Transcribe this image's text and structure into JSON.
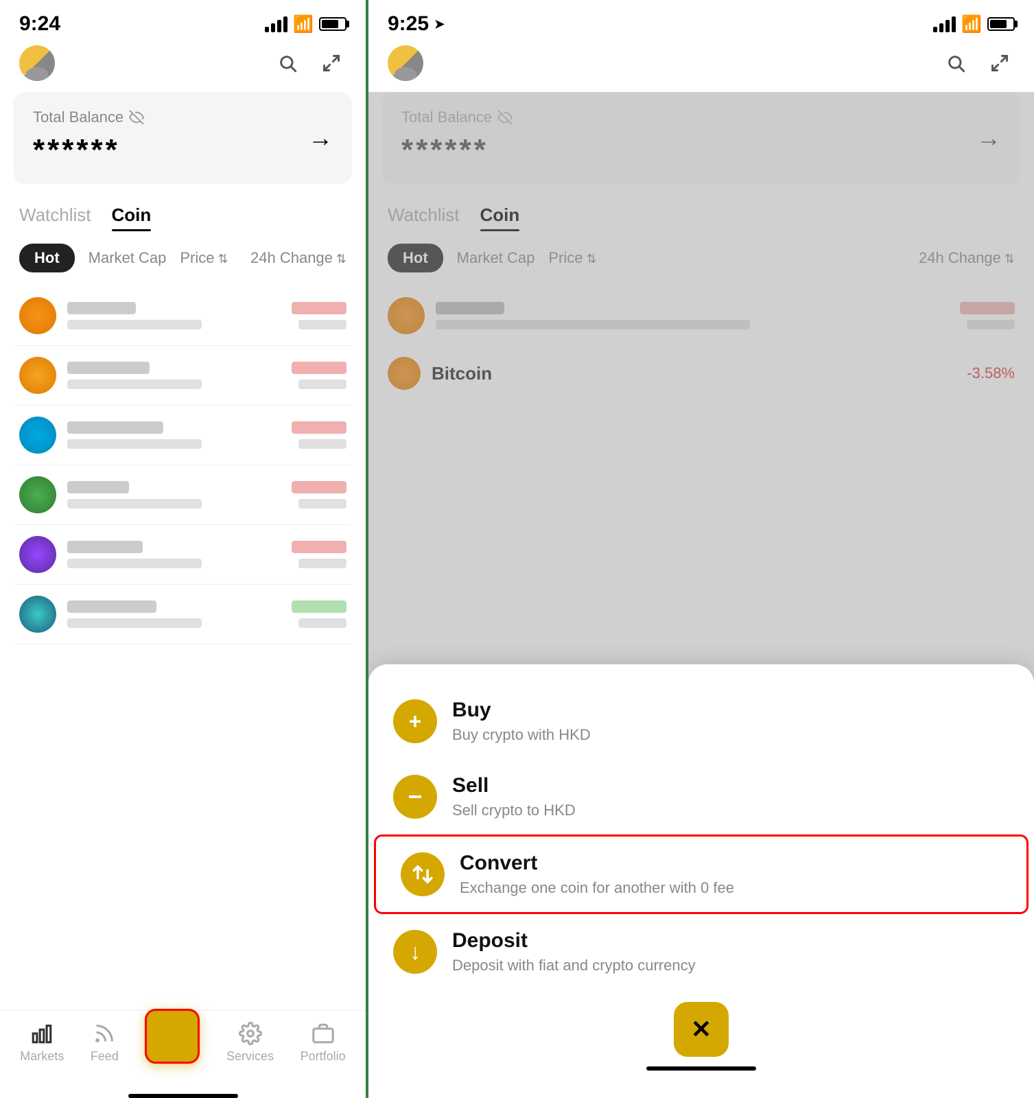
{
  "left": {
    "status": {
      "time": "9:24"
    },
    "header": {
      "search_label": "search",
      "expand_label": "expand"
    },
    "balance": {
      "label": "Total Balance",
      "value": "******",
      "arrow": "→"
    },
    "tabs": [
      {
        "id": "watchlist",
        "label": "Watchlist",
        "active": false
      },
      {
        "id": "coin",
        "label": "Coin",
        "active": true
      }
    ],
    "filters": {
      "hot": "Hot",
      "market_cap": "Market Cap",
      "price": "Price",
      "change": "24h Change"
    },
    "coins": [
      {
        "id": "btc",
        "logo_class": "logo-bitcoin"
      },
      {
        "id": "eth",
        "logo_class": "logo-eth"
      },
      {
        "id": "xrp",
        "logo_class": "logo-xrp"
      },
      {
        "id": "dot",
        "logo_class": "logo-green-dot"
      },
      {
        "id": "sol",
        "logo_class": "logo-sol"
      },
      {
        "id": "ada",
        "logo_class": "logo-ada"
      }
    ],
    "bottom_nav": [
      {
        "id": "markets",
        "label": "Markets",
        "icon": "📊"
      },
      {
        "id": "feed",
        "label": "Feed",
        "icon": "📡"
      },
      {
        "id": "convert",
        "label": "",
        "icon": "⇄",
        "is_fab": true
      },
      {
        "id": "services",
        "label": "Services",
        "icon": "⚙"
      },
      {
        "id": "portfolio",
        "label": "Portfolio",
        "icon": "🗂"
      }
    ]
  },
  "right": {
    "status": {
      "time": "9:25"
    },
    "balance": {
      "label": "Total Balance",
      "value": "******",
      "arrow": "→"
    },
    "tabs": [
      {
        "id": "watchlist",
        "label": "Watchlist",
        "active": false
      },
      {
        "id": "coin",
        "label": "Coin",
        "active": true
      }
    ],
    "filters": {
      "hot": "Hot",
      "market_cap": "Market Cap",
      "price": "Price",
      "change": "24h Change"
    },
    "bitcoin_peek": {
      "name": "Bitcoin",
      "change": "-3.58%"
    },
    "sheet": {
      "items": [
        {
          "id": "buy",
          "icon": "+",
          "title": "Buy",
          "desc": "Buy crypto with HKD",
          "highlighted": false
        },
        {
          "id": "sell",
          "icon": "−",
          "title": "Sell",
          "desc": "Sell crypto to HKD",
          "highlighted": false
        },
        {
          "id": "convert",
          "icon": "⇄",
          "title": "Convert",
          "desc": "Exchange one coin for another with 0 fee",
          "highlighted": true
        },
        {
          "id": "deposit",
          "icon": "↓",
          "title": "Deposit",
          "desc": "Deposit with fiat and crypto currency",
          "highlighted": false
        }
      ],
      "close_icon": "✕"
    }
  }
}
